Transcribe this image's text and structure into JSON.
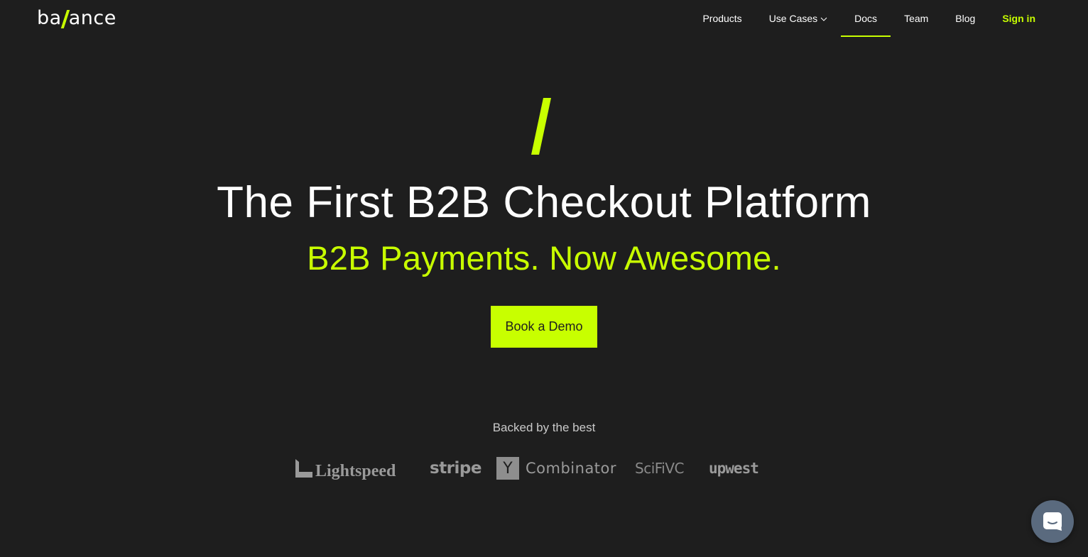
{
  "colors": {
    "background": "#1e1e1e",
    "accent": "#c8ff00",
    "text": "#ffffff",
    "muted": "#9a9a9a"
  },
  "brand": {
    "logo_left": "ba",
    "logo_right": "ance"
  },
  "nav": {
    "items": [
      {
        "label": "Products"
      },
      {
        "label": "Use Cases",
        "icon": "chevron-down-icon"
      },
      {
        "label": "Docs",
        "active": true
      },
      {
        "label": "Team"
      },
      {
        "label": "Blog"
      }
    ],
    "signin": "Sign in"
  },
  "hero": {
    "title": "The First B2B Checkout Platform",
    "subtitle": "B2B Payments. Now Awesome.",
    "cta": "Book a Demo"
  },
  "backers": {
    "heading": "Backed by the best",
    "logos": [
      {
        "name": "Lightspeed",
        "icon": "lightspeed-logo"
      },
      {
        "name": "stripe",
        "icon": "stripe-logo"
      },
      {
        "name": "Combinator",
        "badge": "Y",
        "icon": "y-combinator-logo"
      },
      {
        "name": "SciFiVC",
        "icon": "scifi-vc-logo"
      },
      {
        "name": "upwest",
        "icon": "upwest-logo"
      }
    ]
  },
  "chat": {
    "icon": "chat-bubble-icon"
  }
}
